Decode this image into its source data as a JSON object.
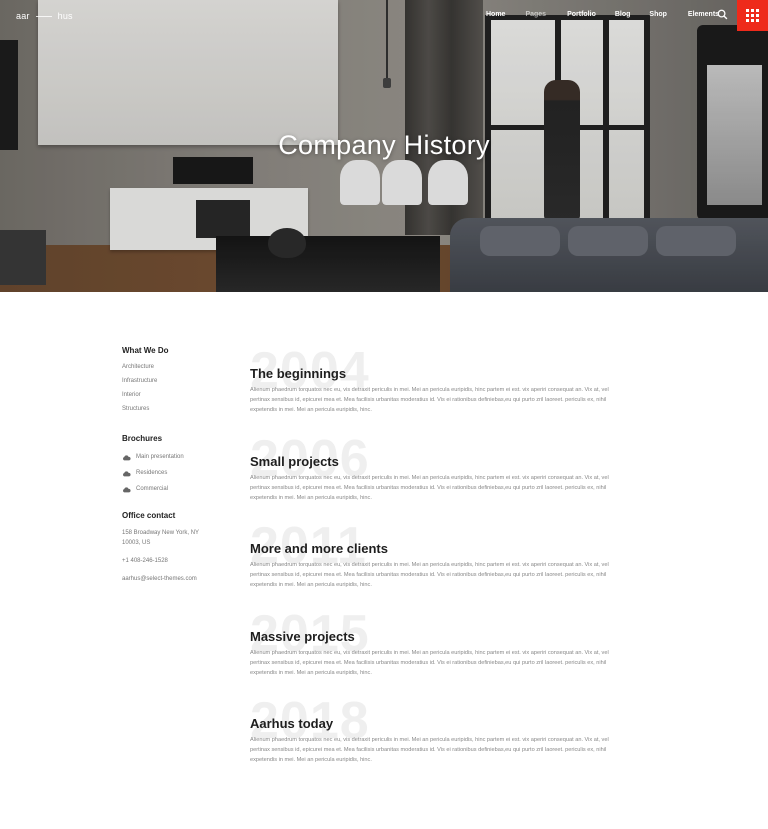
{
  "brand": {
    "logo_left": "aar",
    "logo_right": "hus",
    "accent": "#ee2a1b"
  },
  "nav": {
    "items": [
      "Home",
      "Pages",
      "Portfolio",
      "Blog",
      "Shop",
      "Elements"
    ],
    "search_icon": "search-icon",
    "menu_icon": "grid-menu-icon"
  },
  "hero": {
    "title": "Company History"
  },
  "sidebar": {
    "what_we_do": {
      "title": "What We Do",
      "links": [
        "Architecture",
        "Infrastructure",
        "Interior",
        "Structures"
      ]
    },
    "brochures": {
      "title": "Brochures",
      "items": [
        "Main presentation",
        "Residences",
        "Commercial"
      ],
      "icon": "cloud-download-icon"
    },
    "office": {
      "title": "Office contact",
      "address": "158 Broadway New York, NY 10003, US",
      "phone": "+1 408-246-1528",
      "email": "aarhus@select-themes.com"
    }
  },
  "timeline": [
    {
      "year": "2004",
      "title": "The beginnings",
      "body": "Alienum phaedrum torquatos nec eu, vis detraxit periculis in mei. Mei an pericula euripidis, hinc partem ei est. vix aperiri consequat an. Vix at, vel pertinax sensibus id, epicurei mea et. Mea facilisis urbanitas moderatius id. Vis ei rationibus definiebas,eu qui purto zril laoreet. periculis ex, nihil expetendis in mei. Mei an pericula euripidis, hinc."
    },
    {
      "year": "2006",
      "title": "Small projects",
      "body": "Alienum phaedrum torquatos nec eu, vis detraxit periculis in mei. Mei an pericula euripidis, hinc partem ei est. vix aperiri consequat an. Vix at, vel pertinax sensibus id, epicurei mea et. Mea facilisis urbanitas moderatius id. Vis ei rationibus definiebas,eu qui purto zril laoreet. periculis ex, nihil expetendis in mei. Mei an pericula euripidis, hinc."
    },
    {
      "year": "2011",
      "title": "More and more clients",
      "body": "Alienum phaedrum torquatos nec eu, vis detraxit periculis in mei. Mei an pericula euripidis, hinc partem ei est. vix aperiri consequat an. Vix at, vel pertinax sensibus id, epicurei mea et. Mea facilisis urbanitas moderatius id. Vis ei rationibus definiebas,eu qui purto zril laoreet. periculis ex, nihil expetendis in mei. Mei an pericula euripidis, hinc."
    },
    {
      "year": "2015",
      "title": "Massive projects",
      "body": "Alienum phaedrum torquatos nec eu, vis detraxit periculis in mei. Mei an pericula euripidis, hinc partem ei est. vix aperiri consequat an. Vix at, vel pertinax sensibus id, epicurei mea et. Mea facilisis urbanitas moderatius id. Vis ei rationibus definiebas,eu qui purto zril laoreet. periculis ex, nihil expetendis in mei. Mei an pericula euripidis, hinc."
    },
    {
      "year": "2018",
      "title": "Aarhus today",
      "body": "Alienum phaedrum torquatos nec eu, vis detraxit periculis in mei. Mei an pericula euripidis, hinc partem ei est. vix aperiri consequat an. Vix at, vel pertinax sensibus id, epicurei mea et. Mea facilisis urbanitas moderatius id. Vis ei rationibus definiebas,eu qui purto zril laoreet. periculis ex, nihil expetendis in mei. Mei an pericula euripidis, hinc."
    }
  ]
}
